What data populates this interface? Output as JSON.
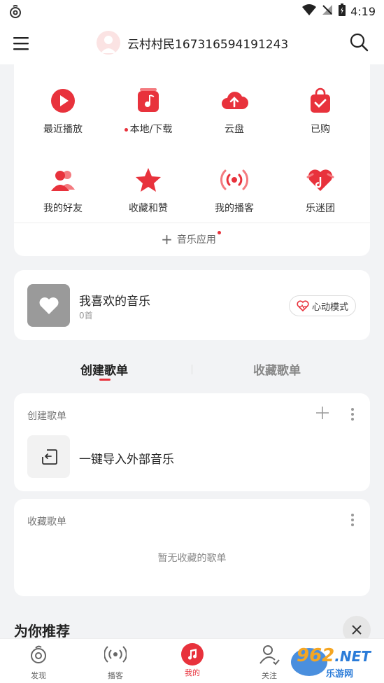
{
  "status_bar": {
    "time": "4:19"
  },
  "header": {
    "username": "云村村民167316594191243"
  },
  "quick_grid": [
    {
      "label": "最近播放",
      "icon": "play-circle-icon"
    },
    {
      "label": "本地/下载",
      "icon": "music-note-icon",
      "has_dot": true
    },
    {
      "label": "云盘",
      "icon": "cloud-upload-icon"
    },
    {
      "label": "已购",
      "icon": "shopping-bag-icon"
    },
    {
      "label": "我的好友",
      "icon": "friends-icon"
    },
    {
      "label": "收藏和赞",
      "icon": "star-icon"
    },
    {
      "label": "我的播客",
      "icon": "podcast-icon"
    },
    {
      "label": "乐迷团",
      "icon": "heart-fans-icon"
    }
  ],
  "music_apps": {
    "label": "音乐应用"
  },
  "favorite": {
    "title": "我喜欢的音乐",
    "count": "0首",
    "heart_mode": "心动模式"
  },
  "tabs": {
    "created": "创建歌单",
    "collected": "收藏歌单"
  },
  "created_section": {
    "title": "创建歌单",
    "import_label": "一键导入外部音乐"
  },
  "collected_section": {
    "title": "收藏歌单",
    "empty": "暂无收藏的歌单"
  },
  "recommend": {
    "title": "为你推荐"
  },
  "bottom_nav": [
    {
      "label": "发现",
      "icon": "discover-icon"
    },
    {
      "label": "播客",
      "icon": "podcast-nav-icon"
    },
    {
      "label": "我的",
      "icon": "music-mine-icon",
      "active": true
    },
    {
      "label": "关注",
      "icon": "follow-icon"
    }
  ],
  "watermark": {
    "digits": "962",
    "suffix": ".NET",
    "sub": "乐游网"
  },
  "colors": {
    "accent": "#e8323c",
    "background": "#f2f3f5"
  }
}
